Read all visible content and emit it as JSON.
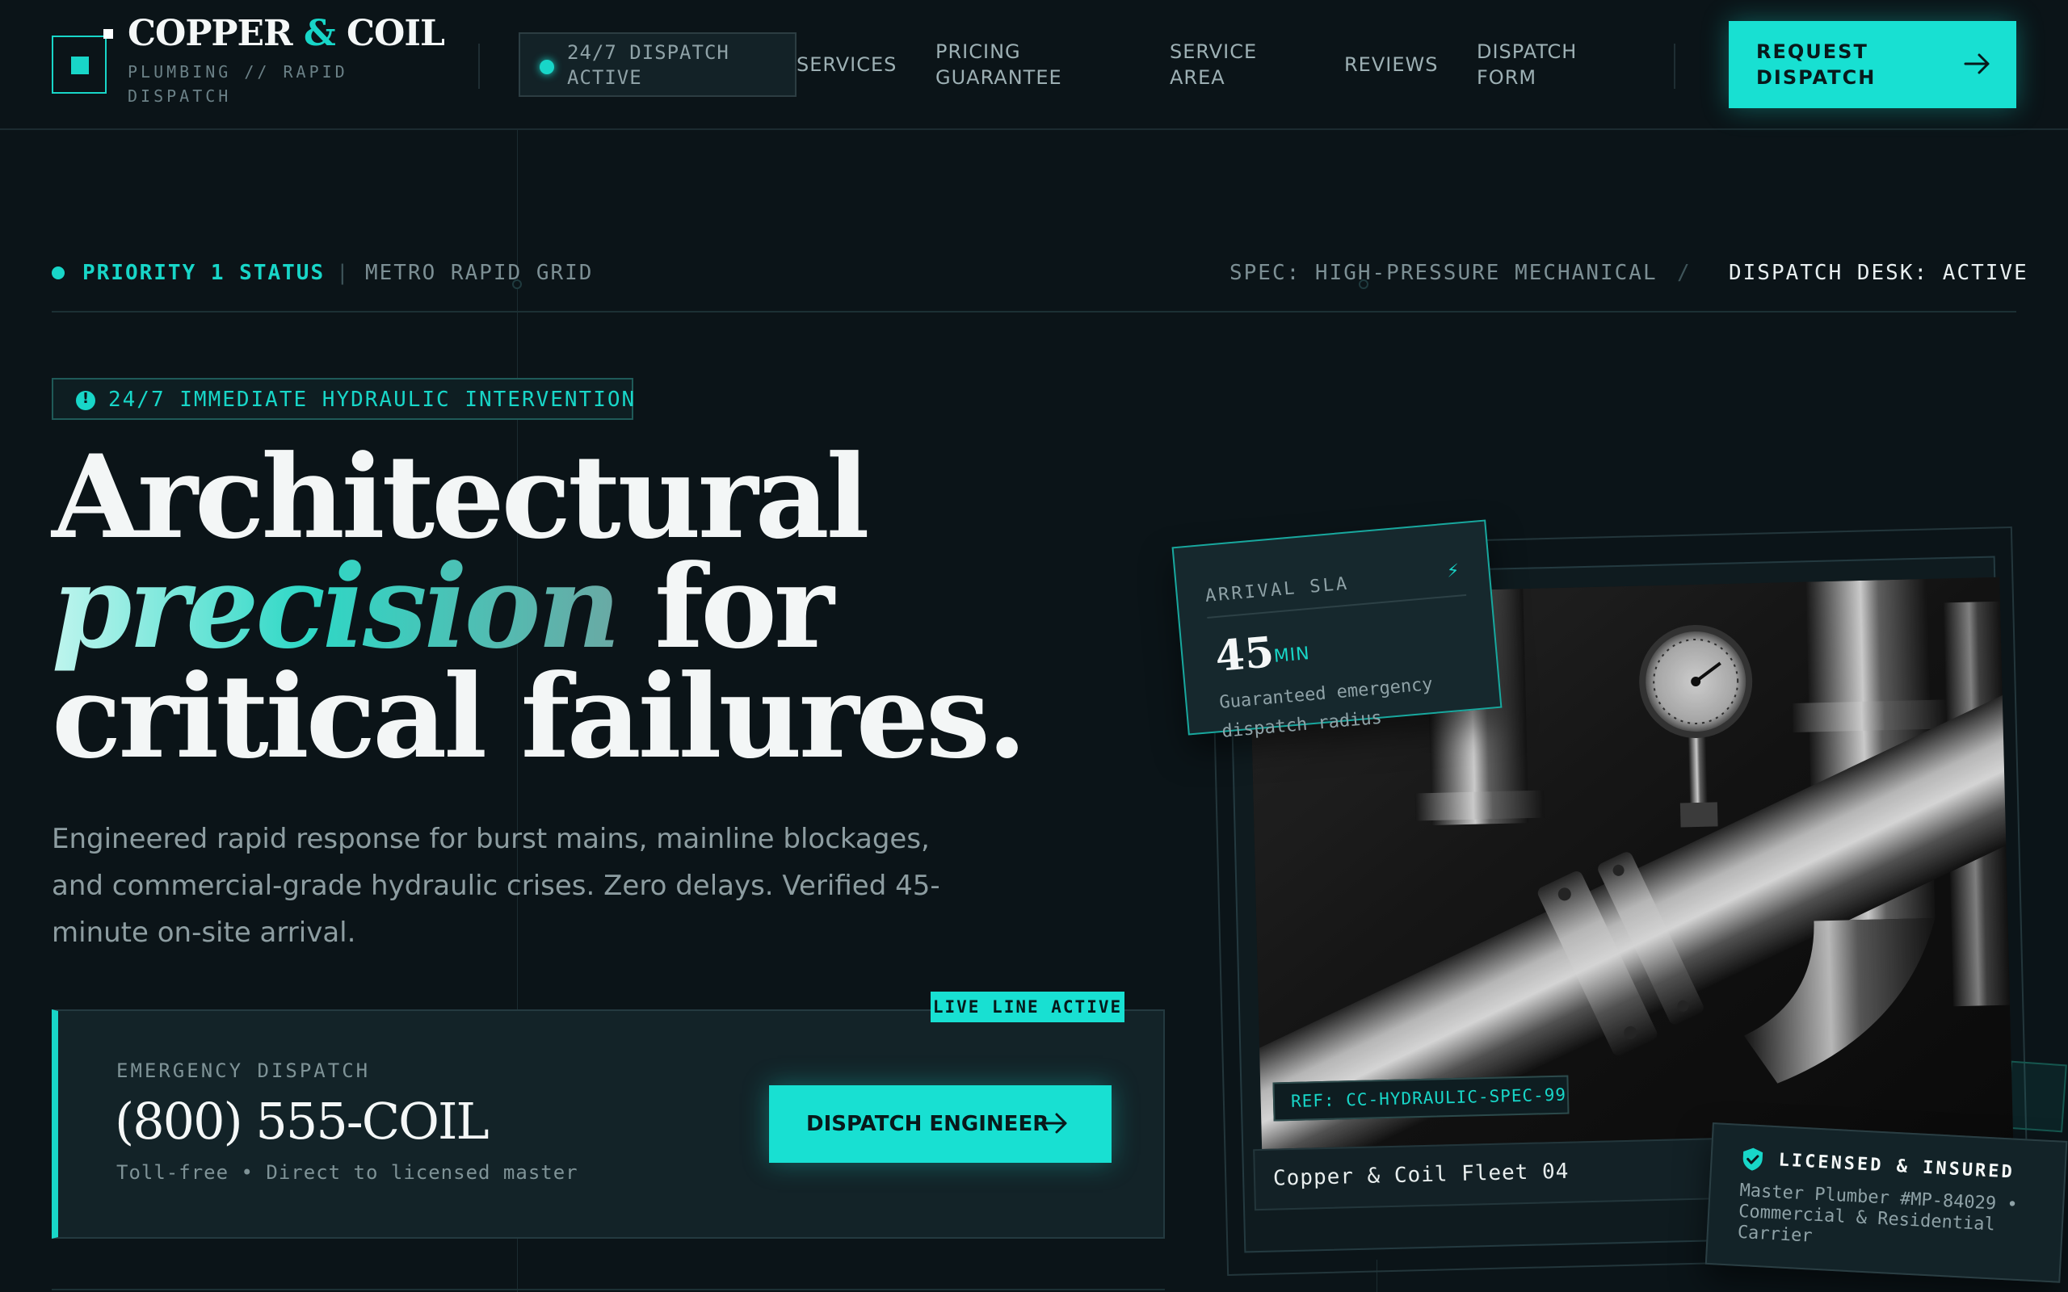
{
  "brand": {
    "name_part1": "COPPER",
    "name_amp": "&",
    "name_part2": "COIL",
    "tagline": "PLUMBING // RAPID DISPATCH"
  },
  "header": {
    "status_pill": "24/7 DISPATCH ACTIVE",
    "nav": [
      {
        "label": "SERVICES"
      },
      {
        "label": "PRICING GUARANTEE"
      },
      {
        "label": "SERVICE AREA"
      },
      {
        "label": "REVIEWS"
      },
      {
        "label": "DISPATCH FORM"
      }
    ],
    "cta_label": "REQUEST DISPATCH"
  },
  "status_strip": {
    "priority": "PRIORITY 1 STATUS",
    "separator": "|",
    "grid": "METRO RAPID GRID",
    "spec": "SPEC: HIGH-PRESSURE MECHANICAL",
    "slash": "/",
    "desk": "DISPATCH DESK: ACTIVE"
  },
  "hero": {
    "badge": "24/7 IMMEDIATE HYDRAULIC INTERVENTION",
    "headline_line1": "Architectural",
    "headline_accent": "precision",
    "headline_line2_rest": " for",
    "headline_line3": "critical failures.",
    "subcopy": "Engineered rapid response for burst mains, mainline blockages, and commercial-grade hydraulic crises. Zero delays. Verified 45-minute on-site arrival."
  },
  "emergency": {
    "live_badge": "LIVE LINE ACTIVE",
    "label": "EMERGENCY DISPATCH",
    "phone": "(800) 555-COIL",
    "note": "Toll-free • Direct to licensed master",
    "button_label": "DISPATCH ENGINEER"
  },
  "visual": {
    "sla_label": "ARRIVAL SLA",
    "sla_icon": "bolt-icon",
    "sla_value": "45",
    "sla_unit": "MIN",
    "sla_desc": "Guaranteed emergency dispatch radius",
    "ref_tag": "REF: CC-HYDRAULIC-SPEC-99",
    "fleet_caption": "Copper & Coil Fleet 04",
    "license_title": "LICENSED & INSURED",
    "license_desc": "Master Plumber #MP-84029 • Commercial & Residential Carrier"
  },
  "colors": {
    "accent": "#18e0d2",
    "background": "#0b1418",
    "card": "#132328"
  }
}
